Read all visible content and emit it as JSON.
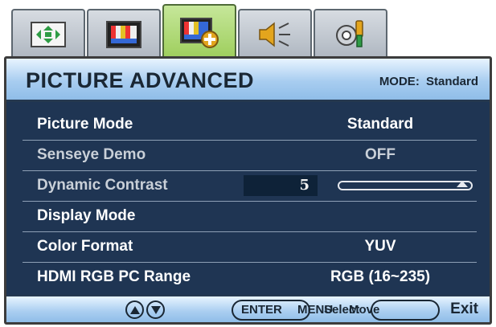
{
  "tabs": [
    {
      "icon": "display-settings-icon",
      "active": false
    },
    {
      "icon": "picture-icon",
      "active": false
    },
    {
      "icon": "picture-advanced-icon",
      "active": true
    },
    {
      "icon": "audio-icon",
      "active": false
    },
    {
      "icon": "system-icon",
      "active": false
    }
  ],
  "header": {
    "title": "PICTURE ADVANCED",
    "mode_label": "MODE:",
    "mode_value": "Standard"
  },
  "rows": [
    {
      "label": "Picture Mode",
      "value": "Standard",
      "enabled": true
    },
    {
      "label": "Senseye Demo",
      "value": "OFF",
      "enabled": false
    },
    {
      "label": "Dynamic Contrast",
      "value": "5",
      "enabled": false,
      "level": 1.0
    },
    {
      "label": "Display Mode",
      "value": "",
      "enabled": true
    },
    {
      "label": "Color Format",
      "value": "YUV",
      "enabled": true
    },
    {
      "label": "HDMI RGB PC Range",
      "value": "RGB (16~235)",
      "enabled": true
    }
  ],
  "footer": {
    "enter": "ENTER",
    "menu": "MENU",
    "select": "Select",
    "move": "Move",
    "exit": "Exit"
  },
  "colors": {
    "panel": "#1f3553",
    "header": "#a8cdf0",
    "tab_active": "#9ccd5a",
    "text_disabled": "#c9d0d8"
  }
}
